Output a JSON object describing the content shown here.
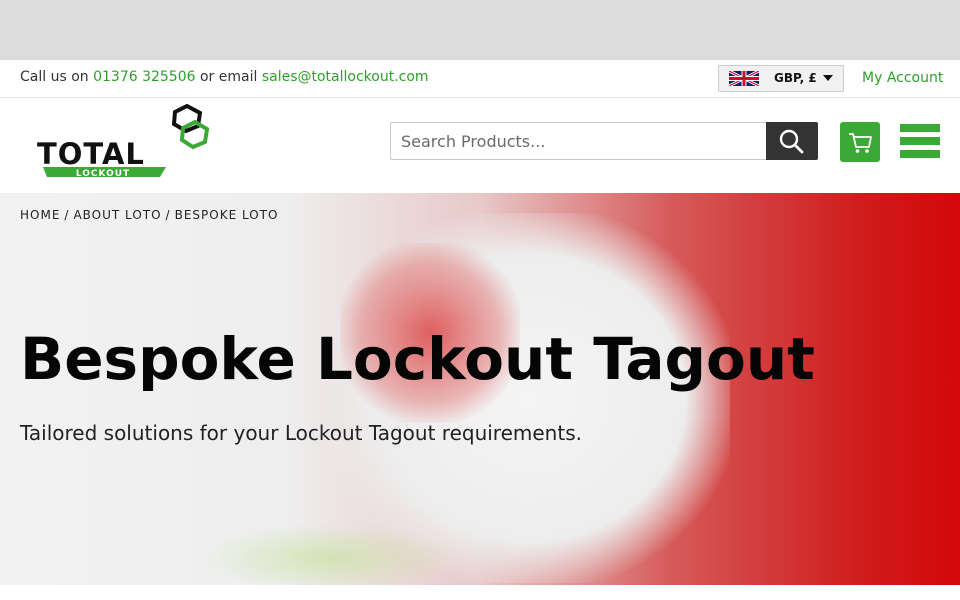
{
  "topbar": {
    "call_label": "Call us on",
    "phone": "01376 325506",
    "email_label": "or email",
    "email": "sales@totallockout.com",
    "currency": "GBP, £",
    "my_account": "My Account"
  },
  "logo": {
    "main": "TOTAL",
    "sub": "LOCKOUT"
  },
  "search": {
    "placeholder": "Search Products..."
  },
  "breadcrumb": [
    "HOME",
    "ABOUT LOTO",
    "BESPOKE LOTO"
  ],
  "hero": {
    "title": "Bespoke Lockout Tagout",
    "tagline": "Tailored solutions for your Lockout Tagout requirements."
  },
  "colors": {
    "brand_green": "#3aa935",
    "link_green": "#2f9f2a",
    "search_button": "#333333"
  },
  "icons": [
    "uk-flag-icon",
    "caret-down-icon",
    "search-icon",
    "cart-icon",
    "hamburger-menu-icon"
  ]
}
